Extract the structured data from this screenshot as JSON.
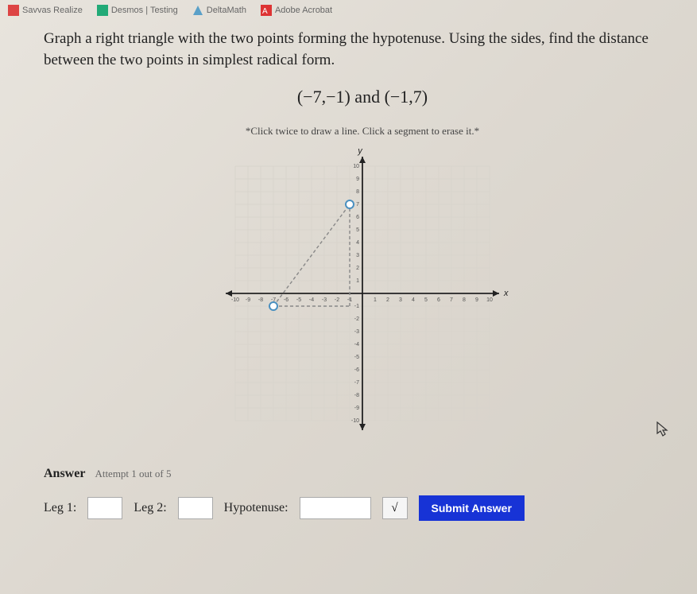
{
  "bookmarks": {
    "realize": "Savvas Realize",
    "desmos": "Desmos | Testing",
    "deltamath": "DeltaMath",
    "acrobat": "Adobe Acrobat"
  },
  "question": "Graph a right triangle with the two points forming the hypotenuse. Using the sides, find the distance between the two points in simplest radical form.",
  "points_text": "(−7,−1) and (−1,7)",
  "hint": "*Click twice to draw a line. Click a segment to erase it.*",
  "axis": {
    "x_label": "x",
    "y_label": "y"
  },
  "answer": {
    "label": "Answer",
    "attempt": "Attempt 1 out of 5",
    "leg1_label": "Leg 1:",
    "leg2_label": "Leg 2:",
    "hyp_label": "Hypotenuse:",
    "sqrt_symbol": "√",
    "submit": "Submit Answer"
  },
  "chart_data": {
    "type": "scatter",
    "title": "",
    "xlabel": "x",
    "ylabel": "y",
    "xlim": [
      -10,
      10
    ],
    "ylim": [
      -10,
      10
    ],
    "grid": true,
    "series": [
      {
        "name": "plotted-points",
        "points": [
          [
            -7,
            -1
          ],
          [
            -1,
            7
          ]
        ]
      },
      {
        "name": "hypotenuse-segment",
        "line": [
          [
            -7,
            -1
          ],
          [
            -1,
            7
          ]
        ],
        "style": "dashed"
      },
      {
        "name": "vertical-leg",
        "line": [
          [
            -1,
            -1
          ],
          [
            -1,
            7
          ]
        ],
        "style": "dashed"
      },
      {
        "name": "horizontal-leg",
        "line": [
          [
            -7,
            -1
          ],
          [
            -1,
            -1
          ]
        ],
        "style": "dashed"
      }
    ],
    "ticks_x": [
      -10,
      -9,
      -8,
      -7,
      -6,
      -5,
      -4,
      -3,
      -2,
      -1,
      1,
      2,
      3,
      4,
      5,
      6,
      7,
      8,
      9,
      10
    ],
    "ticks_y": [
      -10,
      -9,
      -8,
      -7,
      -6,
      -5,
      -4,
      -3,
      -2,
      -1,
      1,
      2,
      3,
      4,
      5,
      6,
      7,
      8,
      9,
      10
    ]
  }
}
